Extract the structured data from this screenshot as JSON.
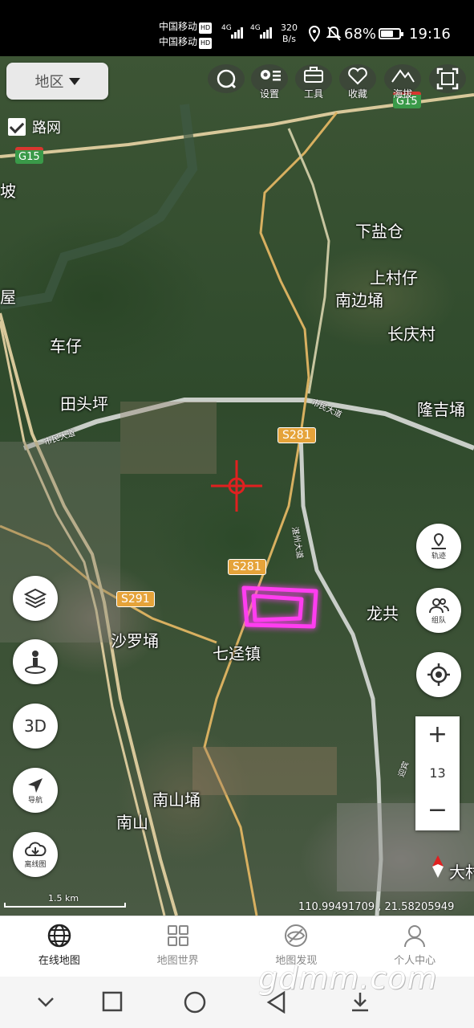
{
  "status_bar": {
    "carrier1": "中国移动",
    "carrier2": "中国移动",
    "hd": "HD",
    "net": "4G",
    "speed_value": "320",
    "speed_unit": "B/s",
    "battery": "68%",
    "battery_level": 0.68,
    "time": "19:16"
  },
  "map": {
    "region_button": "地区",
    "road_network_label": "路网",
    "road_network_checked": true,
    "tools": [
      {
        "icon": "refresh-icon",
        "label": ""
      },
      {
        "icon": "gear-icon",
        "label": "设置"
      },
      {
        "icon": "toolbox-icon",
        "label": "工具"
      },
      {
        "icon": "heart-icon",
        "label": "收藏"
      },
      {
        "icon": "mountain-icon",
        "label": "海拔"
      },
      {
        "icon": "fullscreen-icon",
        "label": ""
      }
    ],
    "place_labels": [
      "下盐仓",
      "上村仔",
      "南边埇",
      "长庆村",
      "车仔",
      "田头坪",
      "隆吉埇",
      "龙共",
      "沙罗埇",
      "七迳镇",
      "南山埇",
      "南山",
      "大村",
      "坡",
      "屋"
    ],
    "road_badges": [
      "S281",
      "S281",
      "S291"
    ],
    "highway_badges": [
      "G15",
      "G15"
    ],
    "road_names": [
      "市民大道",
      "市民大道",
      "湛州大道",
      "迎宾"
    ],
    "left_controls": [
      {
        "icon": "layers-icon",
        "label": ""
      },
      {
        "icon": "street-view-icon",
        "label": ""
      },
      {
        "icon": "3d-icon",
        "label": "3D"
      },
      {
        "icon": "navigate-icon",
        "label": "导航"
      },
      {
        "icon": "offline-map-icon",
        "label": "离线图"
      }
    ],
    "right_controls": [
      {
        "icon": "track-icon",
        "label": "轨迹"
      },
      {
        "icon": "team-icon",
        "label": "组队"
      },
      {
        "icon": "locate-icon",
        "label": ""
      }
    ],
    "zoom_in": "+",
    "zoom_level": "13",
    "zoom_out": "−",
    "scale": "1.5 km",
    "coordinates": "110.99491709 , 21.58205949"
  },
  "bottom_nav": [
    {
      "icon": "globe-icon",
      "label": "在线地图",
      "active": true
    },
    {
      "icon": "grid-icon",
      "label": "地图世界",
      "active": false
    },
    {
      "icon": "discover-icon",
      "label": "地图发现",
      "active": false
    },
    {
      "icon": "person-icon",
      "label": "个人中心",
      "active": false
    }
  ],
  "watermark": "gdmm.com",
  "colors": {
    "route_badge": "#e5a33a",
    "highway_badge": "#3a9a49",
    "highlight": "#ff3df0",
    "crosshair": "#e02020"
  }
}
